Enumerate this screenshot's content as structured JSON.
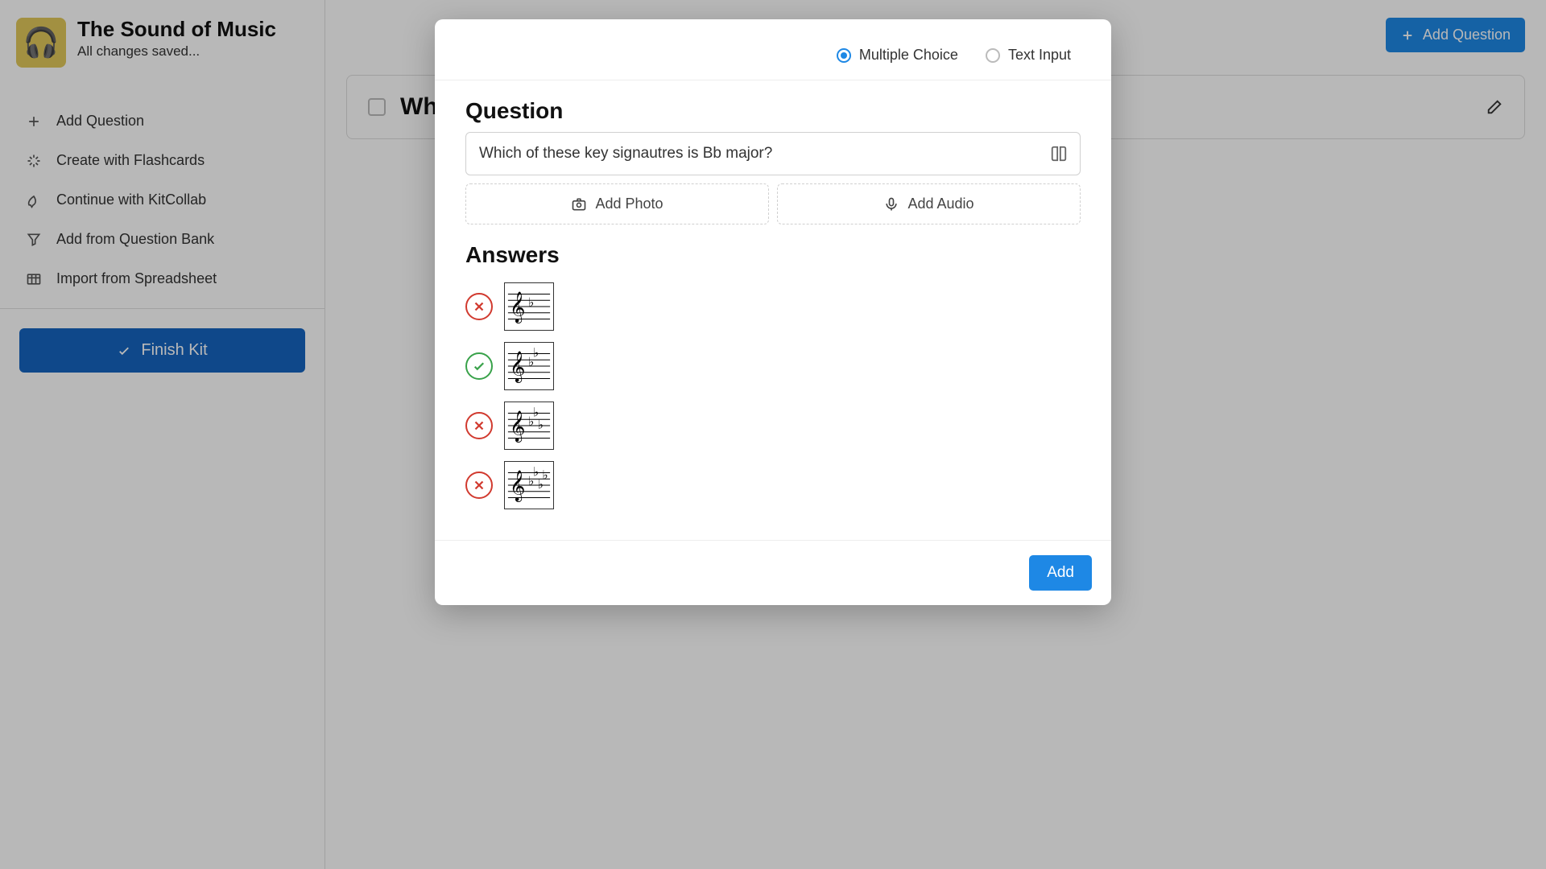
{
  "sidebar": {
    "kit_title": "The Sound of Music",
    "kit_subtitle": "All changes saved...",
    "items": [
      {
        "icon": "plus",
        "label": "Add Question"
      },
      {
        "icon": "sparkle",
        "label": "Create with Flashcards"
      },
      {
        "icon": "rocket",
        "label": "Continue with KitCollab"
      },
      {
        "icon": "filter",
        "label": "Add from Question Bank"
      },
      {
        "icon": "grid",
        "label": "Import from Spreadsheet"
      }
    ],
    "finish_label": "Finish Kit"
  },
  "main": {
    "add_question_label": "Add Question",
    "question_preview": "Wh"
  },
  "modal": {
    "types": {
      "multiple_choice": "Multiple Choice",
      "text_input": "Text Input",
      "selected": "multiple_choice"
    },
    "question_heading": "Question",
    "question_value": "Which of these key signautres is Bb major?",
    "add_photo_label": "Add Photo",
    "add_audio_label": "Add Audio",
    "answers_heading": "Answers",
    "answers": [
      {
        "correct": false,
        "flats": 1
      },
      {
        "correct": true,
        "flats": 2
      },
      {
        "correct": false,
        "flats": 3
      },
      {
        "correct": false,
        "flats": 4
      }
    ],
    "add_label": "Add"
  }
}
